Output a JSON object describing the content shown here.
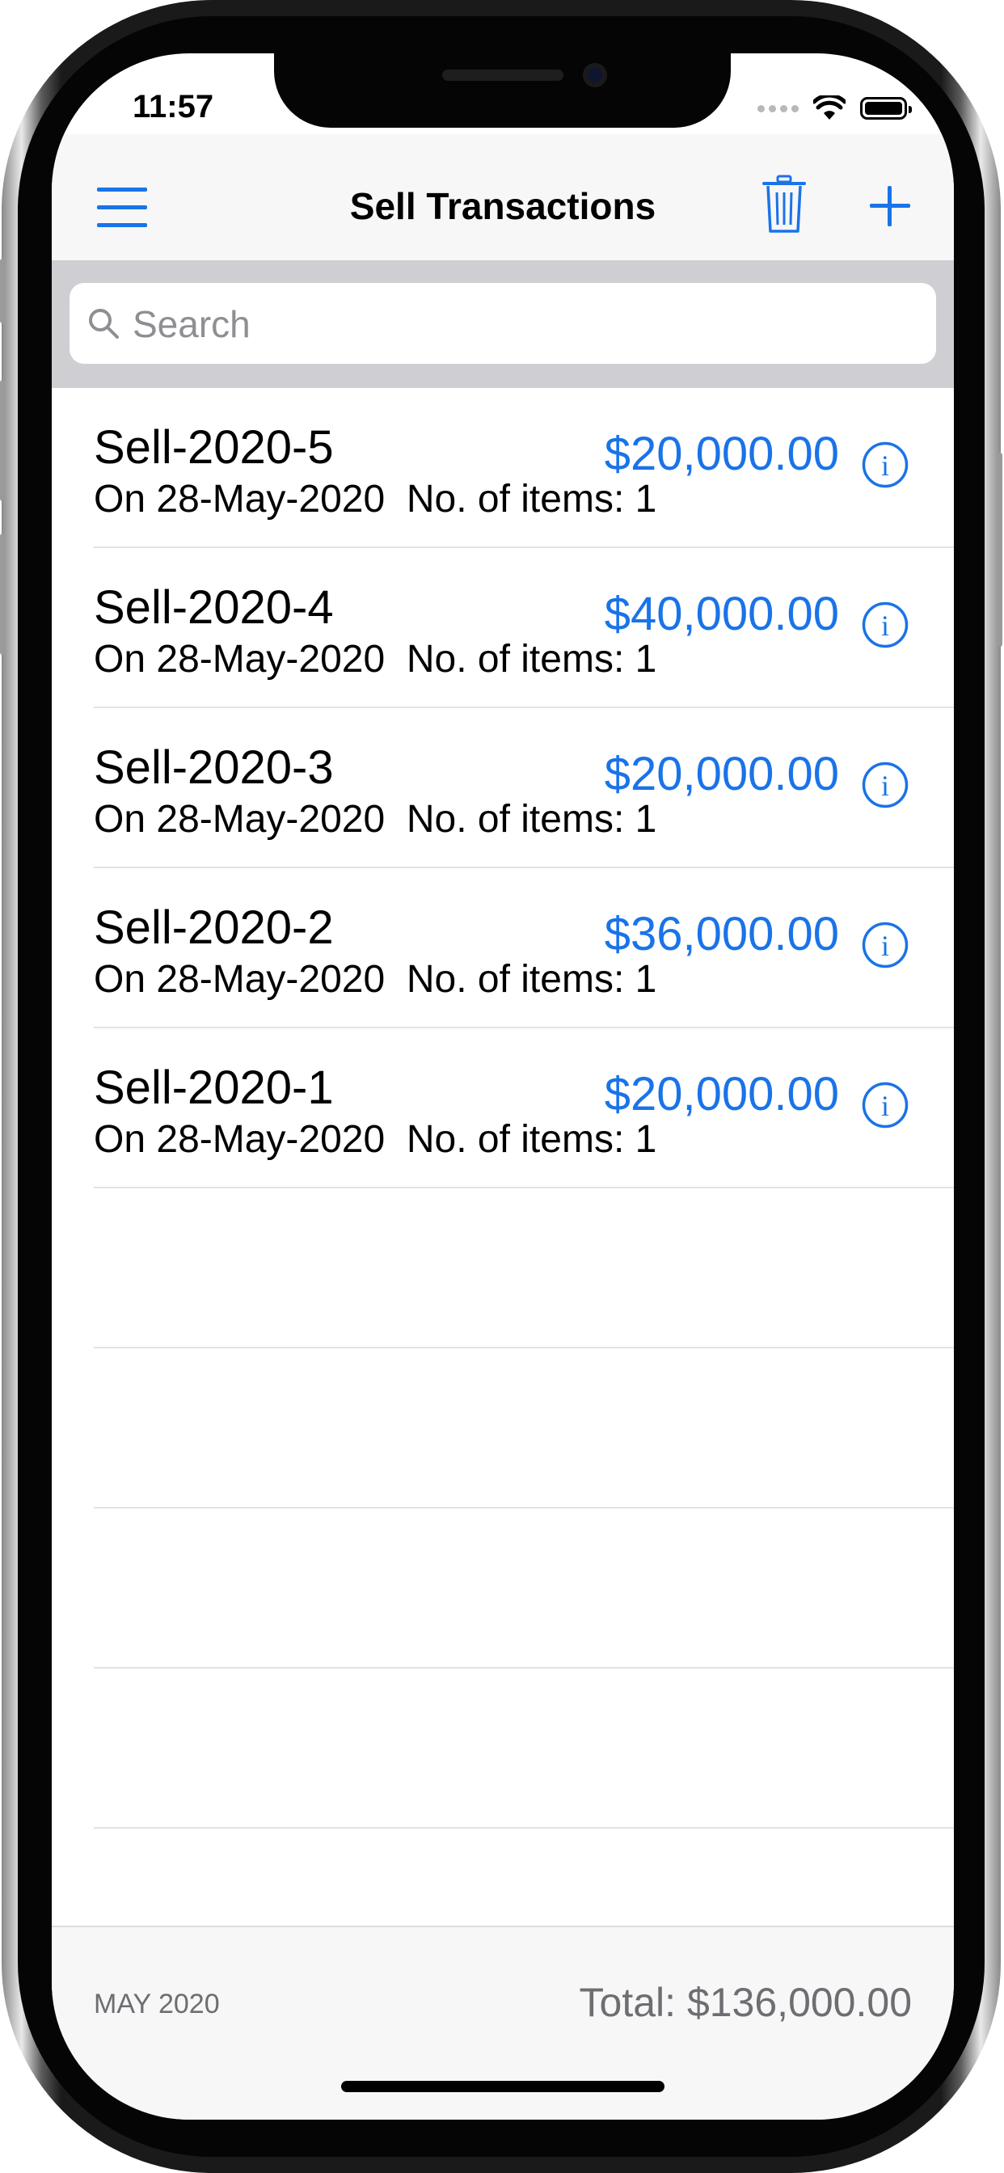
{
  "status_bar": {
    "time": "11:57"
  },
  "nav": {
    "title": "Sell Transactions"
  },
  "search": {
    "placeholder": "Search"
  },
  "transactions": [
    {
      "id": "Sell-2020-5",
      "subtitle": "On 28-May-2020  No. of items: 1",
      "amount": "$20,000.00"
    },
    {
      "id": "Sell-2020-4",
      "subtitle": "On 28-May-2020  No. of items: 1",
      "amount": "$40,000.00"
    },
    {
      "id": "Sell-2020-3",
      "subtitle": "On 28-May-2020  No. of items: 1",
      "amount": "$20,000.00"
    },
    {
      "id": "Sell-2020-2",
      "subtitle": "On 28-May-2020  No. of items: 1",
      "amount": "$36,000.00"
    },
    {
      "id": "Sell-2020-1",
      "subtitle": "On 28-May-2020  No. of items: 1",
      "amount": "$20,000.00"
    }
  ],
  "footer": {
    "month": "MAY 2020",
    "total": "Total: $136,000.00"
  },
  "colors": {
    "accent": "#1a73e8",
    "secondary_text": "#6d6d72"
  },
  "icons": [
    "menu-icon",
    "trash-icon",
    "plus-icon",
    "search-icon",
    "info-icon"
  ]
}
